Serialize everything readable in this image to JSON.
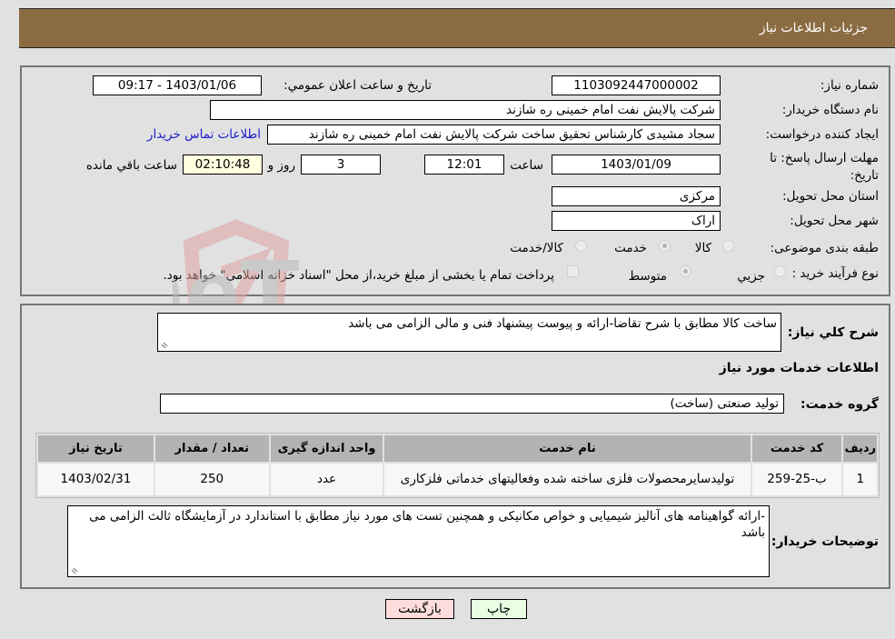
{
  "header": {
    "title": "جزئیات اطلاعات نیاز"
  },
  "details": {
    "need_number_label": "شماره نیاز:",
    "need_number": "1103092447000002",
    "announce_label": "تاريخ و ساعت اعلان عمومي:",
    "announce_value": "1403/01/06 - 09:17",
    "buyer_org_label": "نام دستگاه خريدار:",
    "buyer_org": "شرکت پالایش نفت امام خمینی  ره  شازند",
    "creator_label": "ايجاد کننده درخواست:",
    "creator": "سجاد مشیدی  کارشناس تحقیق ساخت شرکت پالایش نفت امام خمینی  ره  شازند",
    "contact_link": "اطلاعات تماس خريدار",
    "deadline_label": "مهلت ارسال پاسخ: تا تاريخ:",
    "deadline_date": "1403/01/09",
    "time_label": "ساعت",
    "deadline_time": "12:01",
    "days_value": "3",
    "days_label": "روز و",
    "remaining_time": "02:10:48",
    "remaining_label": "ساعت باقي مانده",
    "province_label": "استان محل تحويل:",
    "province": "مرکزی",
    "city_label": "شهر محل تحويل:",
    "city": "اراک",
    "category_label": "طبقه بندی موضوعی:",
    "category_options": [
      {
        "label": "کالا",
        "selected": false
      },
      {
        "label": "خدمت",
        "selected": true
      },
      {
        "label": "کالا/خدمت",
        "selected": false
      }
    ],
    "process_label": "نوع فرآيند خريد :",
    "process_options": [
      {
        "label": "جزيي",
        "selected": false
      },
      {
        "label": "متوسط",
        "selected": true
      }
    ],
    "treasury_note": "پرداخت تمام يا بخشی از مبلغ خريد،از محل \"اسناد خزانه اسلامی\" خواهد بود.",
    "treasury_checked": false
  },
  "summary": {
    "description_label": "شرح کلي نياز:",
    "description": "ساخت کالا مطابق با شرح تقاضا-ارائه و پیوست پیشنهاد فنی و مالی الزامی می باشد",
    "services_heading": "اطلاعات خدمات مورد نياز",
    "service_group_label": "گروه خدمت:",
    "service_group": "تولید صنعتی (ساخت)"
  },
  "table": {
    "headers": [
      "رديف",
      "کد خدمت",
      "نام خدمت",
      "واحد اندازه گيری",
      "تعداد / مقدار",
      "تاريخ نياز"
    ],
    "rows": [
      [
        "1",
        "ب-25-259",
        "تولیدسایرمحصولات فلزی ساخته شده وفعالیتهای خدماتی فلزکاری",
        "عدد",
        "250",
        "1403/02/31"
      ]
    ]
  },
  "buyer_notes": {
    "label": "توضيحات خريدار:",
    "text": "-ارائه گواهینامه های آنالیز شیمیایی و خواص مکانیکی و همچنین تست های مورد نیاز مطابق با  استاندارد در آزمایشگاه ثالث الزامی می باشد"
  },
  "buttons": {
    "print": "چاپ",
    "back": "بازگشت"
  },
  "watermark": {
    "text": "AriaTender.neT"
  },
  "colors": {
    "header_bg": "#8b6c42",
    "back_btn": "#ffdddd",
    "print_btn": "#e8ffe4",
    "remaining_bg": "#ffffe0",
    "link": "#1a1acc"
  }
}
